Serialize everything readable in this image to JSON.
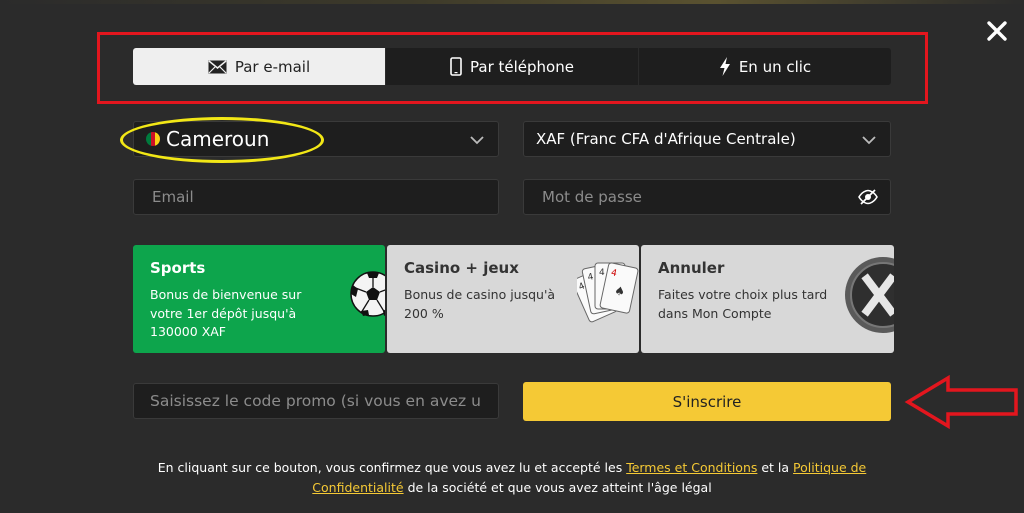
{
  "tabs": [
    {
      "label": "Par e-mail",
      "icon": "envelope-icon",
      "active": true
    },
    {
      "label": "Par téléphone",
      "icon": "phone-icon",
      "active": false
    },
    {
      "label": "En un clic",
      "icon": "lightning-icon",
      "active": false
    }
  ],
  "country": {
    "value": "Cameroun",
    "flag_colors": [
      "#007a3d",
      "#ce1126",
      "#fcd116"
    ]
  },
  "currency": {
    "value": "XAF (Franc CFA d'Afrique Centrale)"
  },
  "fields": {
    "email_placeholder": "Email",
    "password_placeholder": "Mot de passe",
    "promo_placeholder": "Saisissez le code promo (si vous en avez un)"
  },
  "bonus_cards": [
    {
      "title": "Sports",
      "description": "Bonus de bienvenue sur votre 1er dépôt jusqu'à 130000 XAF",
      "icon": "soccer-ball-icon"
    },
    {
      "title": "Casino + jeux",
      "description": "Bonus de casino jusqu'à 200 %",
      "icon": "playing-cards-icon"
    },
    {
      "title": "Annuler",
      "description": "Faites votre choix plus tard dans Mon Compte",
      "icon": "cancel-x-icon"
    }
  ],
  "signup_label": "S'inscrire",
  "legal": {
    "text_1": "En cliquant sur ce bouton, vous confirmez que vous avez lu et accepté les ",
    "terms_link": "Termes et Conditions",
    "text_2": " et la ",
    "privacy_link": "Politique de Confidentialité",
    "text_3": " de la société et que vous avez atteint l'âge légal"
  },
  "colors": {
    "background": "#2b2b2b",
    "field": "#1e1e1e",
    "accent_yellow": "#f5c935",
    "sports_green": "#0da54c",
    "annotation_red": "#e3161e",
    "annotation_yellow": "#f2e716"
  }
}
